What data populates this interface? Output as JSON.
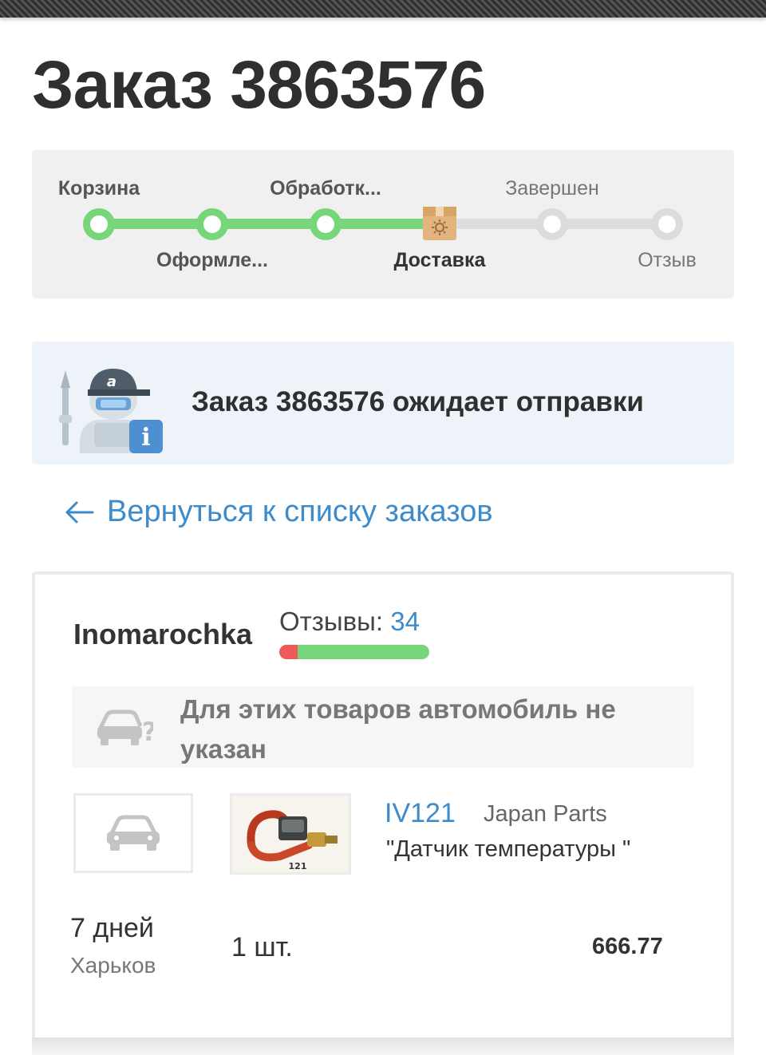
{
  "order": {
    "title": "Заказ 3863576"
  },
  "progress": {
    "steps": [
      {
        "label": "Корзина",
        "state": "done"
      },
      {
        "label": "Оформле...",
        "state": "done"
      },
      {
        "label": "Обработк...",
        "state": "done"
      },
      {
        "label": "Доставка",
        "state": "current"
      },
      {
        "label": "Завершен",
        "state": "todo"
      },
      {
        "label": "Отзыв",
        "state": "todo"
      }
    ]
  },
  "banner": {
    "text": "Заказ 3863576 ожидает отправки"
  },
  "back_link": {
    "label": "Вернуться к списку заказов"
  },
  "seller": {
    "name": "Inomarochka",
    "reviews_label": "Отзывы:",
    "reviews_count": "34",
    "negative_share": 0.12
  },
  "vehicle_note": {
    "text": "Для этих товаров автомобиль не указан"
  },
  "item": {
    "part_number": "IV121",
    "brand": "Japan Parts",
    "name": "\"Датчик температуры \"",
    "delivery_days": "7 дней",
    "delivery_city": "Харьков",
    "quantity": "1 шт.",
    "price": "666.77",
    "image_label": "121"
  },
  "colors": {
    "accent_green": "#77d57a",
    "link_blue": "#3d8bcb",
    "negative_red": "#ef5a5a",
    "package_tan": "#e3b47e"
  }
}
